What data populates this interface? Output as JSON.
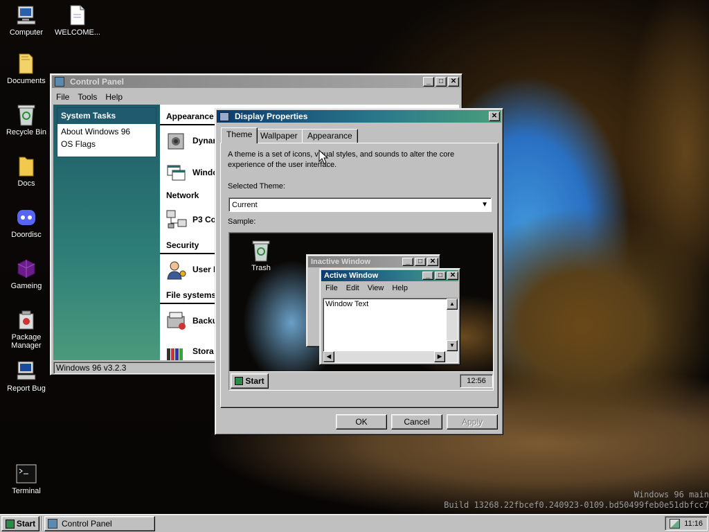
{
  "desktop_icons": [
    {
      "label": "Computer",
      "icon": "computer-icon"
    },
    {
      "label": "WELCOME...",
      "icon": "document-icon"
    },
    {
      "label": "Documents",
      "icon": "folder-icon"
    },
    {
      "label": "Recycle Bin",
      "icon": "recycle-bin-icon"
    },
    {
      "label": "Docs",
      "icon": "folder-icon"
    },
    {
      "label": "Doordisc",
      "icon": "discord-icon"
    },
    {
      "label": "Gameing",
      "icon": "game-cube-icon"
    },
    {
      "label": "Package Manager",
      "icon": "package-icon"
    },
    {
      "label": "Report Bug",
      "icon": "computer-icon"
    },
    {
      "label": "Terminal",
      "icon": "terminal-icon"
    }
  ],
  "control_panel": {
    "title": "Control Panel",
    "menu": [
      "File",
      "Tools",
      "Help"
    ],
    "tasks_header": "System Tasks",
    "tasks": [
      "About Windows 96",
      "OS Flags"
    ],
    "sections": {
      "appearance": "Appearance",
      "network": "Network",
      "security": "Security",
      "file_systems": "File systems"
    },
    "items": [
      "Dynan",
      "Windo",
      "P3 Co",
      "User I",
      "Backu",
      "Stora"
    ],
    "status": "Windows 96 v3.2.3"
  },
  "display_properties": {
    "title": "Display Properties",
    "tabs": [
      "Theme",
      "Wallpaper",
      "Appearance"
    ],
    "active_tab": "Theme",
    "description": "A theme is a set of icons, visual styles, and sounds to alter the core experience of the user interface.",
    "selected_theme_label": "Selected Theme:",
    "selected_theme_value": "Current",
    "sample_label": "Sample:",
    "sample": {
      "trash_label": "Trash",
      "inactive_title": "Inactive Window",
      "active_title": "Active Window",
      "menu": [
        "File",
        "Edit",
        "View",
        "Help"
      ],
      "window_text": "Window Text",
      "start": "Start",
      "clock": "12:56"
    },
    "buttons": {
      "ok": "OK",
      "cancel": "Cancel",
      "apply": "Apply"
    }
  },
  "watermark": {
    "line1": "Windows 96 main",
    "line2": "Build 13268.22fbcef0.240923-0109.bd50499feb0e51dbfcc7"
  },
  "taskbar": {
    "start": "Start",
    "tasks": [
      "Control Panel"
    ],
    "clock": "11:16"
  },
  "colors": {
    "title_active": "#0c3b6e",
    "face": "#c0c0c0",
    "cp_sidebar": "#2c6a6e"
  }
}
